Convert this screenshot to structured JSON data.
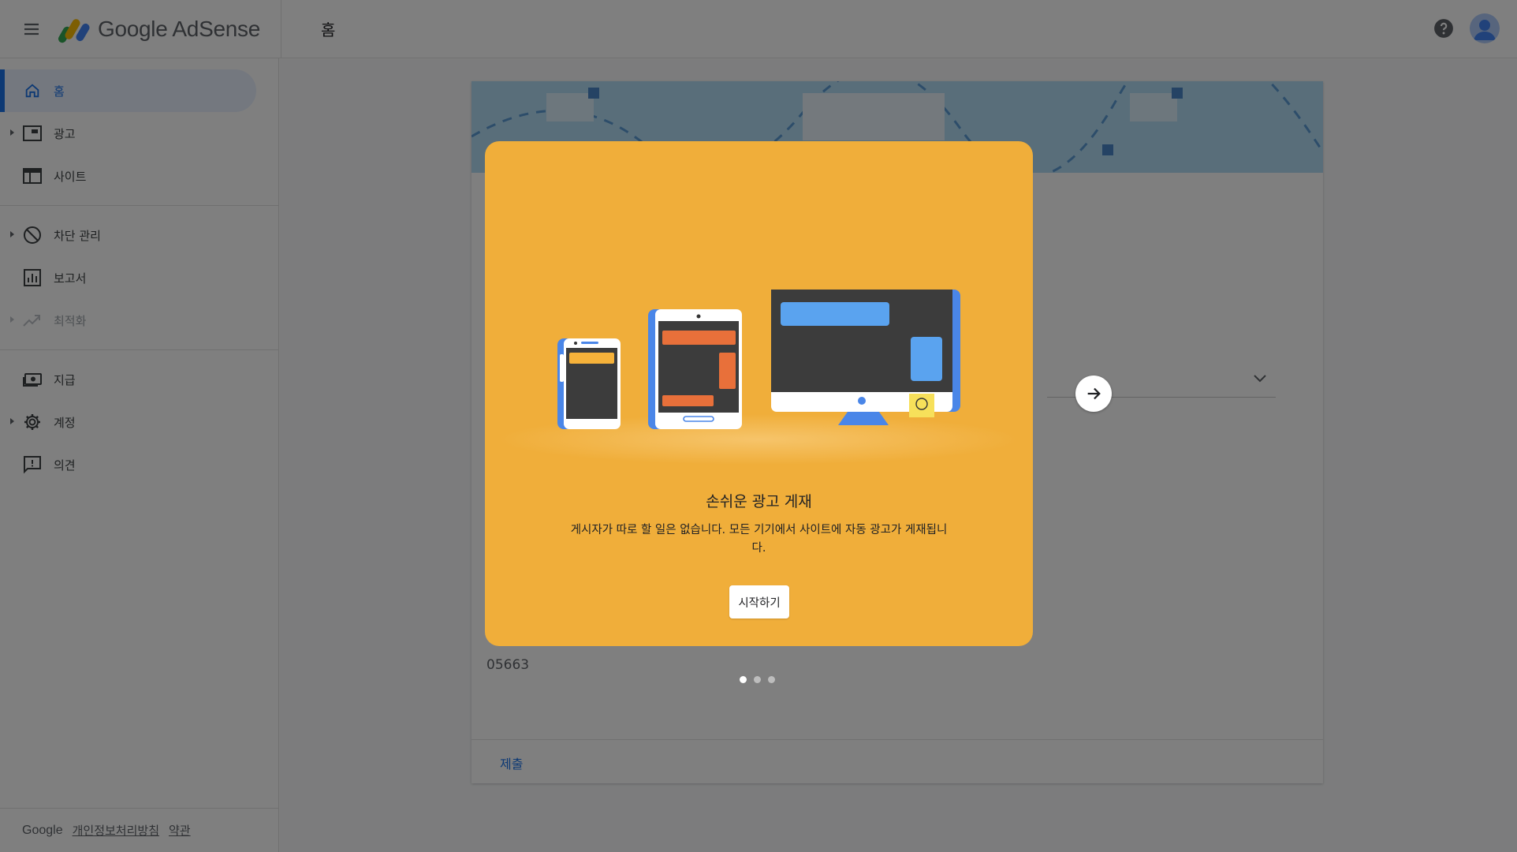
{
  "header": {
    "product_name": "Google AdSense",
    "page_title": "홈",
    "icons": {
      "menu": "menu-icon",
      "help": "help-icon",
      "account": "avatar"
    }
  },
  "sidebar": {
    "items": [
      {
        "label": "홈",
        "icon": "home-icon",
        "active": true
      },
      {
        "label": "광고",
        "icon": "ads-icon",
        "expandable": true
      },
      {
        "label": "사이트",
        "icon": "sites-icon"
      },
      {
        "label": "차단 관리",
        "icon": "block-icon",
        "expandable": true
      },
      {
        "label": "보고서",
        "icon": "reports-icon"
      },
      {
        "label": "최적화",
        "icon": "optimization-icon",
        "expandable": true,
        "disabled": true
      },
      {
        "label": "지급",
        "icon": "payments-icon"
      },
      {
        "label": "계정",
        "icon": "gear-icon",
        "expandable": true
      },
      {
        "label": "의견",
        "icon": "feedback-icon"
      }
    ],
    "footer": {
      "brand": "Google",
      "privacy": "개인정보처리방침",
      "terms": "약관"
    }
  },
  "card": {
    "number": "05663",
    "submit_label": "제출"
  },
  "modal": {
    "title": "손쉬운 광고 게재",
    "description": "게시자가 따로 할 일은 없습니다. 모든 기기에서 사이트에 자동 광고가 게재됩니다.",
    "start_label": "시작하기",
    "background_color": "#f0ae3a"
  },
  "carousel": {
    "total": 3,
    "current": 1
  },
  "colors": {
    "accent": "#1a73e8",
    "overlay": "rgba(0,0,0,0.5)"
  }
}
